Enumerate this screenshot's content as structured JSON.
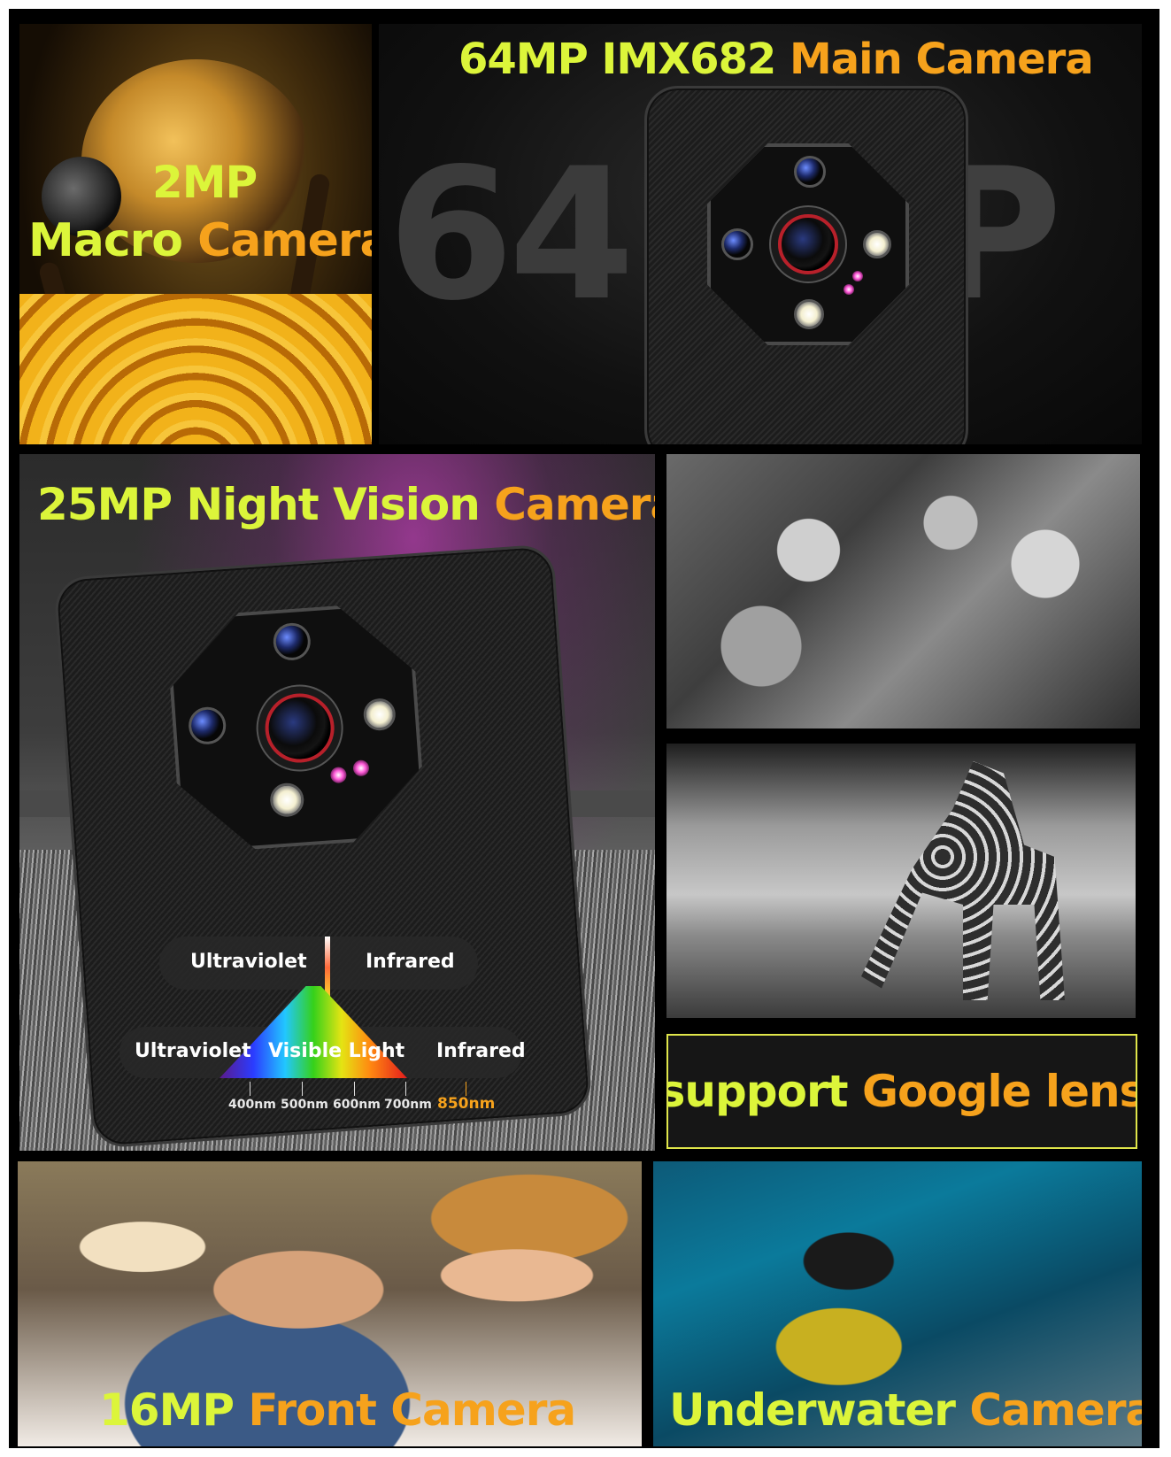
{
  "colors": {
    "lime": "#dcf53a",
    "orange": "#f6a21c",
    "background": "#000000"
  },
  "macro_panel": {
    "line1": "2MP",
    "line2_a": "Macro",
    "line2_b": "Camera"
  },
  "main_panel": {
    "title_a": "64MP IMX682",
    "title_b": "Main Camera",
    "bg_text_left": "64",
    "bg_text_right": "P"
  },
  "night_panel": {
    "title_a": "25MP Night Vision",
    "title_b": "Camera",
    "top_left_label": "Ultraviolet",
    "top_right_label": "Infrared",
    "bottom_left_label": "Ultraviolet",
    "center_label": "Visible Light",
    "bottom_right_label": "Infrared",
    "wavelengths": [
      "400nm",
      "500nm",
      "600nm",
      "700nm",
      "850nm"
    ]
  },
  "google_lens": {
    "text_a": "support",
    "text_b": "Google lens"
  },
  "front_panel": {
    "text_a": "16MP",
    "text_b": "Front Camera"
  },
  "underwater_panel": {
    "text_a": "Underwater",
    "text_b": "Camera"
  },
  "icons": [
    "bee-photo",
    "rugged-phone",
    "giraffe-photo",
    "explorers-photo",
    "selfie-photo",
    "diver-photo"
  ]
}
